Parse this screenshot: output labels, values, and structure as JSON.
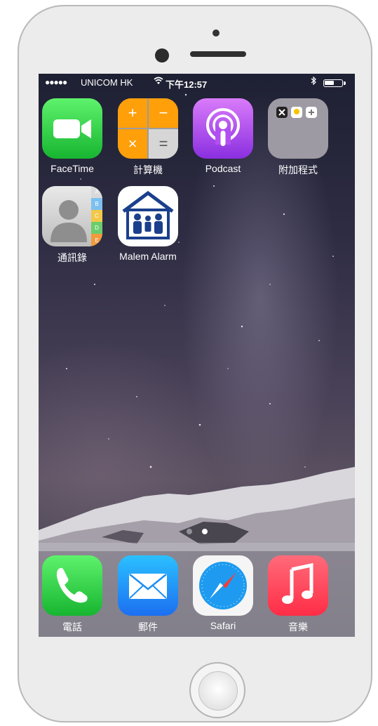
{
  "status_bar": {
    "signal": "●●●●●",
    "carrier": "UNICOM HK",
    "time": "下午12:57"
  },
  "home_screen": {
    "apps": [
      {
        "id": "facetime",
        "label": "FaceTime"
      },
      {
        "id": "calculator",
        "label": "計算機",
        "keys": [
          "+",
          "−",
          "×",
          "="
        ]
      },
      {
        "id": "podcast",
        "label": "Podcast"
      },
      {
        "id": "extras",
        "label": "附加程式"
      },
      {
        "id": "contacts",
        "label": "通訊錄",
        "index_tabs": [
          "A",
          "B",
          "C",
          "D",
          "E"
        ]
      },
      {
        "id": "malem",
        "label": "Malem Alarm"
      }
    ],
    "page_count": 2,
    "current_page": 2
  },
  "dock": {
    "apps": [
      {
        "id": "phone",
        "label": "電話"
      },
      {
        "id": "mail",
        "label": "郵件"
      },
      {
        "id": "safari",
        "label": "Safari"
      },
      {
        "id": "music",
        "label": "音樂"
      }
    ]
  },
  "colors": {
    "facetime": "#2ed14a",
    "calculator_operators": "#ff9f0a",
    "podcast": "#b14ff0",
    "mail": "#1c8ff5",
    "music": "#ff3b57",
    "malem_blue": "#1a3f8c"
  },
  "battery_level": 0.55
}
